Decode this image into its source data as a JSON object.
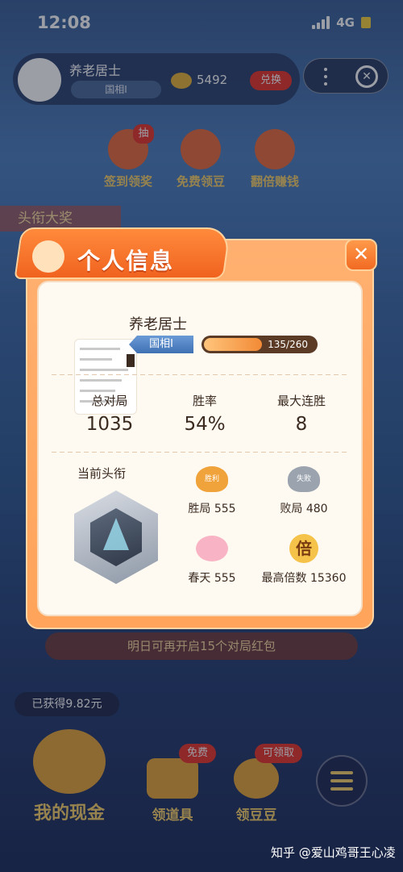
{
  "status": {
    "time": "12:08",
    "network": "4G"
  },
  "topbar": {
    "name": "养老居士",
    "rank": "国相I",
    "coins": "5492",
    "exchange": "兑换"
  },
  "actions": [
    {
      "label": "签到领奖",
      "badge": "抽"
    },
    {
      "label": "免费领豆"
    },
    {
      "label": "翻倍赚钱"
    }
  ],
  "headline_tag": "头衔大奖",
  "modal": {
    "title": "个人信息",
    "player": {
      "name": "养老居士",
      "rank": "国相I",
      "exp_text": "135/260",
      "exp_fraction": 0.519
    },
    "stats": [
      {
        "label": "总对局",
        "value": "1035"
      },
      {
        "label": "胜率",
        "value": "54%"
      },
      {
        "label": "最大连胜",
        "value": "8"
      }
    ],
    "current_title_label": "当前头衔",
    "details": [
      {
        "icon": "win-laurel-icon",
        "icon_text": "胜利",
        "label": "胜局 555"
      },
      {
        "icon": "lose-laurel-icon",
        "icon_text": "失败",
        "label": "败局 480"
      },
      {
        "icon": "spring-blossom-icon",
        "label": "春天 555"
      },
      {
        "icon": "multiplier-icon",
        "icon_text": "倍",
        "label": "最高倍数 15360"
      }
    ]
  },
  "banner": "明日可再开启15个对局红包",
  "earned": "已获得9.82元",
  "bottom_nav": [
    {
      "label": "我的现金"
    },
    {
      "label": "领道具",
      "badge": "免费"
    },
    {
      "label": "领豆豆",
      "badge": "可领取"
    }
  ],
  "watermark": "知乎 @爱山鸡哥王心凌"
}
